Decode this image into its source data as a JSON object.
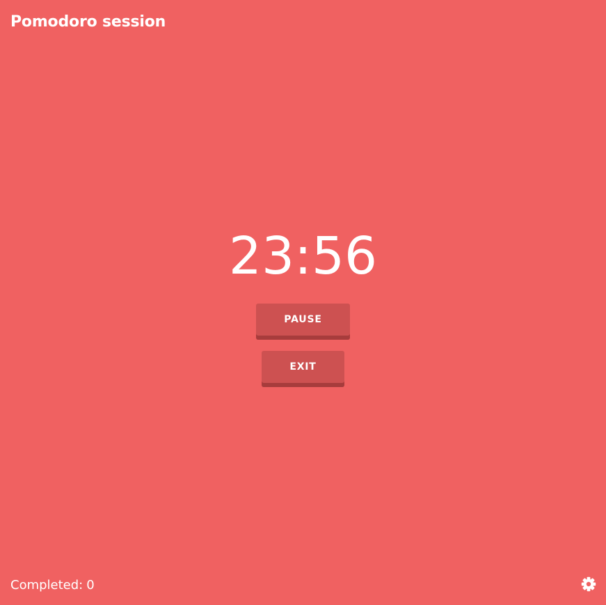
{
  "header": {
    "title": "Pomodoro session"
  },
  "timer": {
    "display": "23:56"
  },
  "controls": {
    "pause_label": "PAUSE",
    "exit_label": "EXIT"
  },
  "footer": {
    "completed_label": "Completed:",
    "completed_count": "0",
    "settings_icon": "gear-icon"
  },
  "colors": {
    "background": "#f06161",
    "button": "#cd5151",
    "button_shadow": "#a73c3c",
    "text": "#ffffff"
  }
}
